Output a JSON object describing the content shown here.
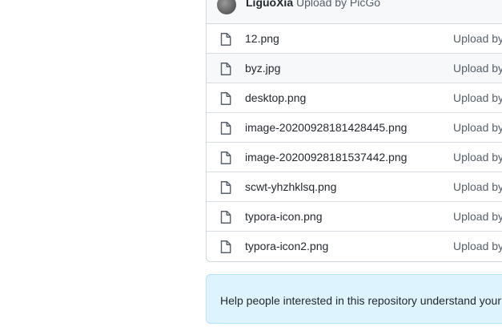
{
  "commit_header": {
    "author": "LiguoXia",
    "message": "Upload by PicGo"
  },
  "files": [
    {
      "name": "12.png",
      "commit": "Upload by PicGo",
      "icon": "file-icon"
    },
    {
      "name": "byz.jpg",
      "commit": "Upload by PicGo",
      "icon": "file-icon"
    },
    {
      "name": "desktop.png",
      "commit": "Upload by PicGo",
      "icon": "file-icon"
    },
    {
      "name": "image-20200928181428445.png",
      "commit": "Upload by PicGo",
      "icon": "file-icon"
    },
    {
      "name": "image-20200928181537442.png",
      "commit": "Upload by PicGo",
      "icon": "file-icon"
    },
    {
      "name": "scwt-yhzhklsq.png",
      "commit": "Upload by PicGo",
      "icon": "file-icon"
    },
    {
      "name": "typora-icon.png",
      "commit": "Upload by PicGo",
      "icon": "file-icon"
    },
    {
      "name": "typora-icon2.png",
      "commit": "Upload by PicGo",
      "icon": "file-icon"
    }
  ],
  "readme_prompt": {
    "text": "Help people interested in this repository understand your project by adding a README."
  },
  "colors": {
    "row_hover": "#f6f8fa",
    "prompt_bg": "#ddf4ff",
    "border": "#d0d7de"
  }
}
